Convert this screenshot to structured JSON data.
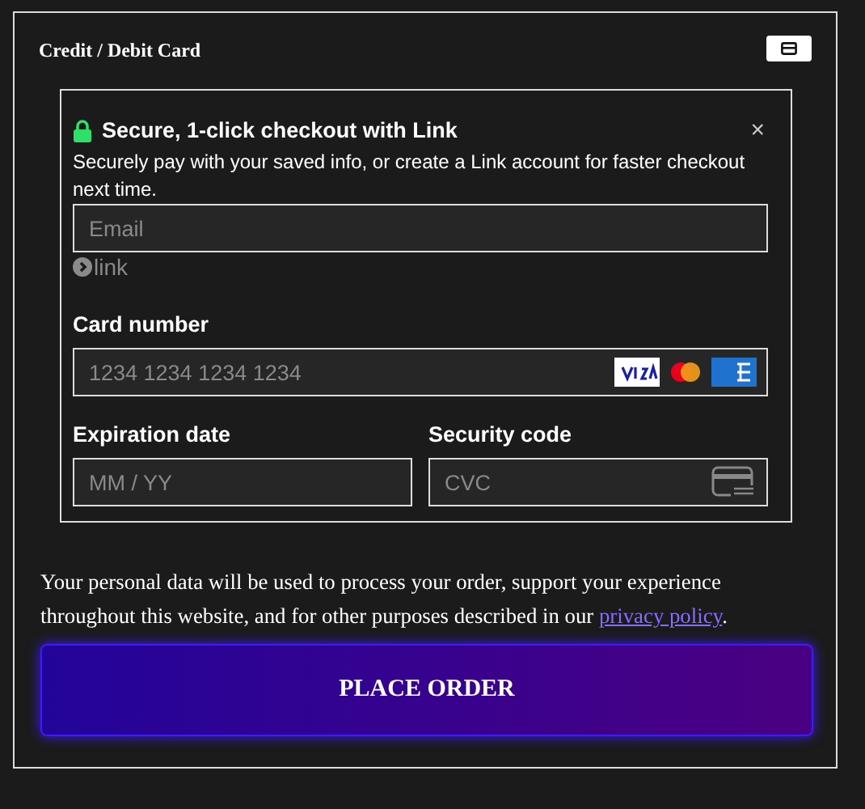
{
  "payment_method": {
    "title": "Credit / Debit Card"
  },
  "link_banner": {
    "title": "Secure, 1-click checkout with Link",
    "description": "Securely pay with your saved info, or create a Link account for faster checkout next time.",
    "close": "×"
  },
  "email": {
    "placeholder": "Email"
  },
  "link_logo": "link",
  "card_number": {
    "label": "Card number",
    "placeholder": "1234 1234 1234 1234"
  },
  "expiry": {
    "label": "Expiration date",
    "placeholder": "MM / YY"
  },
  "security_code": {
    "label": "Security code",
    "placeholder": "CVC"
  },
  "consent": {
    "text": "Your personal data will be used to process your order, support your experience throughout this website, and for other purposes described in our ",
    "link": "privacy policy",
    "end": "."
  },
  "place_order": "PLACE ORDER"
}
